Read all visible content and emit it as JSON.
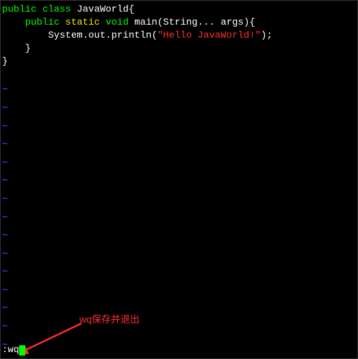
{
  "code": {
    "l1": {
      "kw1": "public",
      "kw2": "class",
      "name": " JavaWorld",
      "brace": "{"
    },
    "l2": {
      "indent": "    ",
      "kw1": "public",
      "kw2": " static",
      "kw3": " void",
      "method": " main",
      "paren1": "(",
      "type": "String",
      "varargs": "...",
      "arg": " args",
      "paren2": ")",
      "brace": "{"
    },
    "l3": {
      "indent": "        ",
      "call": "System.out.println",
      "paren1": "(",
      "str": "\"Hello JavaWorld!\"",
      "paren2": ")",
      "semi": ";"
    },
    "l4": {
      "indent": "    ",
      "brace": "}"
    },
    "l5": {
      "brace": "}"
    }
  },
  "tilde": "~",
  "cmd": {
    "prefix": ":",
    "text": "wq"
  },
  "annotation": "wq保存并退出"
}
